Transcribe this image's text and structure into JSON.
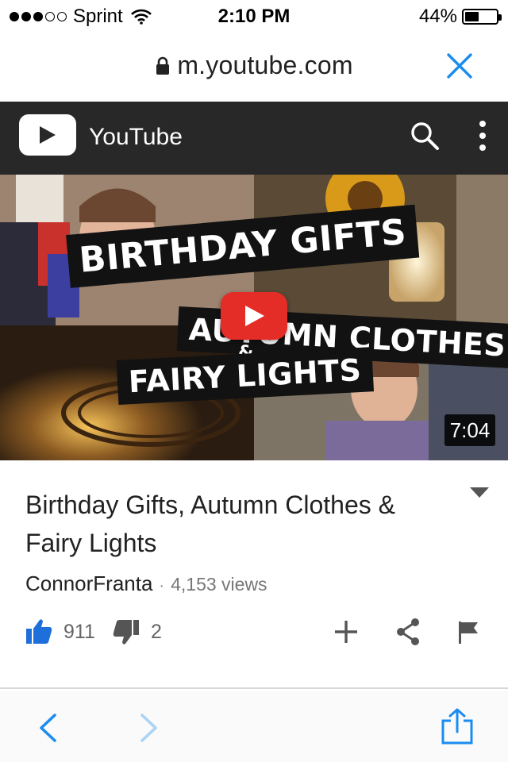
{
  "status_bar": {
    "carrier": "Sprint",
    "signal_bars_filled": 3,
    "signal_bars_total": 5,
    "time": "2:10 PM",
    "battery_percent_label": "44%",
    "battery_level": 0.44
  },
  "url_bar": {
    "url": "m.youtube.com",
    "icons": [
      "lock-icon",
      "close-icon"
    ],
    "accent_color": "#1a8cf0"
  },
  "youtube_header": {
    "brand": "YouTube",
    "icons": [
      "youtube-play-icon",
      "search-icon",
      "more-vert-icon"
    ],
    "background_color": "#282828"
  },
  "thumbnail": {
    "banner_line_1": "BIRTHDAY GIFTS",
    "banner_line_2": "AUTUMN CLOTHES",
    "banner_amp": "&",
    "banner_line_3": "FAIRY LIGHTS",
    "duration": "7:04",
    "play_button_color": "#e52d27"
  },
  "video": {
    "title": "Birthday Gifts, Autumn Clothes & Fairy Lights",
    "channel": "ConnorFranta",
    "separator": "·",
    "views": "4,153 views"
  },
  "actions": {
    "likes": "911",
    "dislikes": "2",
    "icons": [
      "thumbs-up-icon",
      "thumbs-down-icon",
      "add-icon",
      "share-icon",
      "flag-icon"
    ],
    "like_color": "#1e6fd9"
  },
  "bottom_bar": {
    "icons": [
      "back-icon",
      "forward-icon",
      "share-icon"
    ],
    "accent_color": "#1a8cf0"
  }
}
